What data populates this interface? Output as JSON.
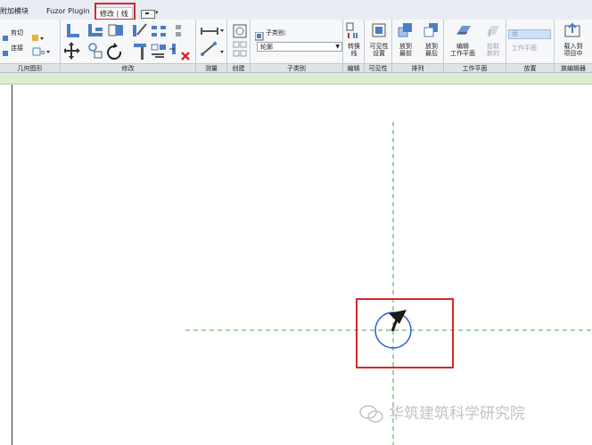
{
  "tabs": [
    {
      "label": "附加模块",
      "active": false
    },
    {
      "label": "Fuzor Plugin",
      "active": false
    },
    {
      "label": "修改 | 线",
      "active": true
    }
  ],
  "ribbon": {
    "geometry": {
      "cut": "剪切",
      "join": "连接"
    },
    "subcategory": {
      "title": "子类别:",
      "value": "轮廓"
    },
    "buttons": {
      "convert_line": "转换\n线",
      "visibility_settings": "可见性\n设置",
      "bring_front": "放到\n最前",
      "send_back": "放到\n最后",
      "edit_workplane": "编辑\n工作平面",
      "pick_new": "拾取\n新的",
      "load_project": "载入到\n项目中"
    },
    "place_dropdown": "面",
    "workplane_btn": "工作平面",
    "groups": [
      "几何图形",
      "修改",
      "测量",
      "创建",
      "子类别",
      "编辑",
      "可见性",
      "排列",
      "工作平面",
      "放置",
      "族编辑器"
    ]
  },
  "watermark": "华筑建筑科学研究院",
  "colors": {
    "highlight": "#d6282c",
    "refline": "#3fa73f",
    "circle": "#2b5fd0"
  }
}
